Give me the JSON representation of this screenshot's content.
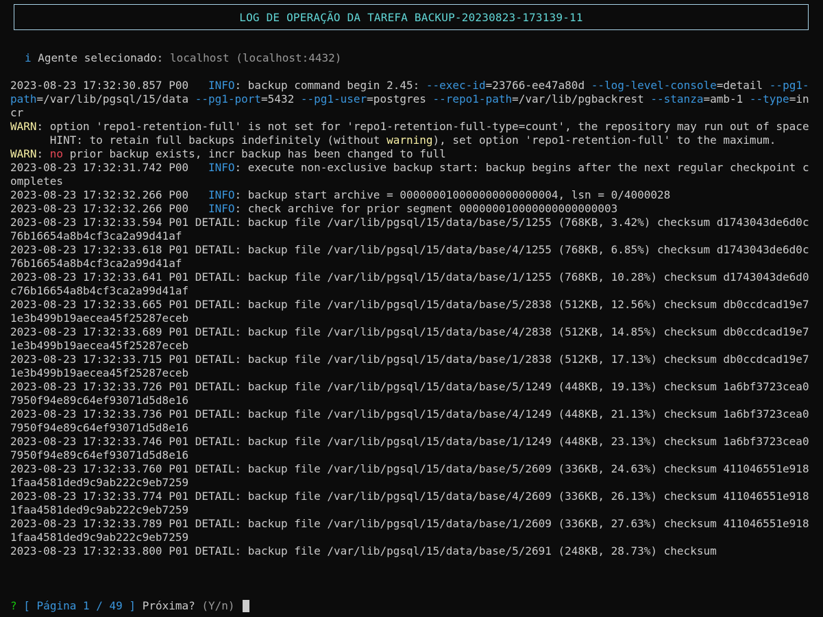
{
  "header": {
    "title": "LOG DE OPERAÇÃO DA TAREFA BACKUP-20230823-173139-11"
  },
  "agent": {
    "icon": "i",
    "label": "Agente selecionado:",
    "host": "localhost (localhost:4432)"
  },
  "log_lines": [
    [
      {
        "t": "2023-08-23 17:32:30.857 P00   "
      },
      {
        "t": "INFO",
        "c": "blue"
      },
      {
        "t": ": backup command begin 2.45: "
      },
      {
        "t": "--exec-id",
        "c": "blue"
      },
      {
        "t": "=23766-ee47a80d "
      },
      {
        "t": "--log-level-console",
        "c": "blue"
      },
      {
        "t": "=detail "
      },
      {
        "t": "--pg1-path",
        "c": "blue"
      },
      {
        "t": "=/var/lib/pgsql/15/data "
      },
      {
        "t": "--pg1-port",
        "c": "blue"
      },
      {
        "t": "=5432 "
      },
      {
        "t": "--pg1-user",
        "c": "blue"
      },
      {
        "t": "=postgres "
      },
      {
        "t": "--repo1-path",
        "c": "blue"
      },
      {
        "t": "=/var/lib/pgbackrest "
      },
      {
        "t": "--stanza",
        "c": "blue"
      },
      {
        "t": "=amb-1 "
      },
      {
        "t": "--type",
        "c": "blue"
      },
      {
        "t": "=incr"
      }
    ],
    [
      {
        "t": "WARN",
        "c": "warn"
      },
      {
        "t": ": option 'repo1-retention-full' is not set for 'repo1-retention-full-type=count', the repository may run out of space"
      }
    ],
    [
      {
        "t": "      HINT: to retain full backups indefinitely (without "
      },
      {
        "t": "warning",
        "c": "warn"
      },
      {
        "t": "), set option 'repo1-retention-full' to the maximum."
      }
    ],
    [
      {
        "t": "WARN",
        "c": "warn"
      },
      {
        "t": ": "
      },
      {
        "t": "no",
        "c": "red"
      },
      {
        "t": " prior backup exists, incr backup has been changed to full"
      }
    ],
    [
      {
        "t": "2023-08-23 17:32:31.742 P00   "
      },
      {
        "t": "INFO",
        "c": "blue"
      },
      {
        "t": ": execute non-exclusive backup start: backup begins after the next regular checkpoint completes"
      }
    ],
    [
      {
        "t": "2023-08-23 17:32:32.266 P00   "
      },
      {
        "t": "INFO",
        "c": "blue"
      },
      {
        "t": ": backup start archive = 000000010000000000000004, lsn = 0/4000028"
      }
    ],
    [
      {
        "t": "2023-08-23 17:32:32.266 P00   "
      },
      {
        "t": "INFO",
        "c": "blue"
      },
      {
        "t": ": check archive for prior segment 000000010000000000000003"
      }
    ],
    [
      {
        "t": "2023-08-23 17:32:33.594 P01 DETAIL: backup file /var/lib/pgsql/15/data/base/5/1255 (768KB, 3.42%) checksum d1743043de6d0c76b16654a8b4cf3ca2a99d41af"
      }
    ],
    [
      {
        "t": "2023-08-23 17:32:33.618 P01 DETAIL: backup file /var/lib/pgsql/15/data/base/4/1255 (768KB, 6.85%) checksum d1743043de6d0c76b16654a8b4cf3ca2a99d41af"
      }
    ],
    [
      {
        "t": "2023-08-23 17:32:33.641 P01 DETAIL: backup file /var/lib/pgsql/15/data/base/1/1255 (768KB, 10.28%) checksum d1743043de6d0c76b16654a8b4cf3ca2a99d41af"
      }
    ],
    [
      {
        "t": "2023-08-23 17:32:33.665 P01 DETAIL: backup file /var/lib/pgsql/15/data/base/5/2838 (512KB, 12.56%) checksum db0ccdcad19e71e3b499b19aecea45f25287eceb"
      }
    ],
    [
      {
        "t": "2023-08-23 17:32:33.689 P01 DETAIL: backup file /var/lib/pgsql/15/data/base/4/2838 (512KB, 14.85%) checksum db0ccdcad19e71e3b499b19aecea45f25287eceb"
      }
    ],
    [
      {
        "t": "2023-08-23 17:32:33.715 P01 DETAIL: backup file /var/lib/pgsql/15/data/base/1/2838 (512KB, 17.13%) checksum db0ccdcad19e71e3b499b19aecea45f25287eceb"
      }
    ],
    [
      {
        "t": "2023-08-23 17:32:33.726 P01 DETAIL: backup file /var/lib/pgsql/15/data/base/5/1249 (448KB, 19.13%) checksum 1a6bf3723cea07950f94e89c64ef93071d5d8e16"
      }
    ],
    [
      {
        "t": "2023-08-23 17:32:33.736 P01 DETAIL: backup file /var/lib/pgsql/15/data/base/4/1249 (448KB, 21.13%) checksum 1a6bf3723cea07950f94e89c64ef93071d5d8e16"
      }
    ],
    [
      {
        "t": "2023-08-23 17:32:33.746 P01 DETAIL: backup file /var/lib/pgsql/15/data/base/1/1249 (448KB, 23.13%) checksum 1a6bf3723cea07950f94e89c64ef93071d5d8e16"
      }
    ],
    [
      {
        "t": "2023-08-23 17:32:33.760 P01 DETAIL: backup file /var/lib/pgsql/15/data/base/5/2609 (336KB, 24.63%) checksum 411046551e9181faa4581ded9c9ab222c9eb7259"
      }
    ],
    [
      {
        "t": "2023-08-23 17:32:33.774 P01 DETAIL: backup file /var/lib/pgsql/15/data/base/4/2609 (336KB, 26.13%) checksum 411046551e9181faa4581ded9c9ab222c9eb7259"
      }
    ],
    [
      {
        "t": "2023-08-23 17:32:33.789 P01 DETAIL: backup file /var/lib/pgsql/15/data/base/1/2609 (336KB, 27.63%) checksum 411046551e9181faa4581ded9c9ab222c9eb7259"
      }
    ],
    [
      {
        "t": "2023-08-23 17:32:33.800 P01 DETAIL: backup file /var/lib/pgsql/15/data/base/5/2691 (248KB, 28.73%) checksum"
      }
    ]
  ],
  "prompt": {
    "question_mark": "?",
    "page_label": "[ Página 1 / 49 ]",
    "next_label": "Próxima?",
    "choices": "(Y/n)"
  },
  "colors": {
    "background": "#0c0c0c",
    "text": "#cccccc",
    "title": "#61d6d6",
    "info": "#3a96dd",
    "warn": "#f9f1a5",
    "error": "#e74856",
    "prompt_mark": "#16c60c"
  },
  "icons": {
    "agent": "info-icon",
    "cursor": "text-cursor"
  }
}
